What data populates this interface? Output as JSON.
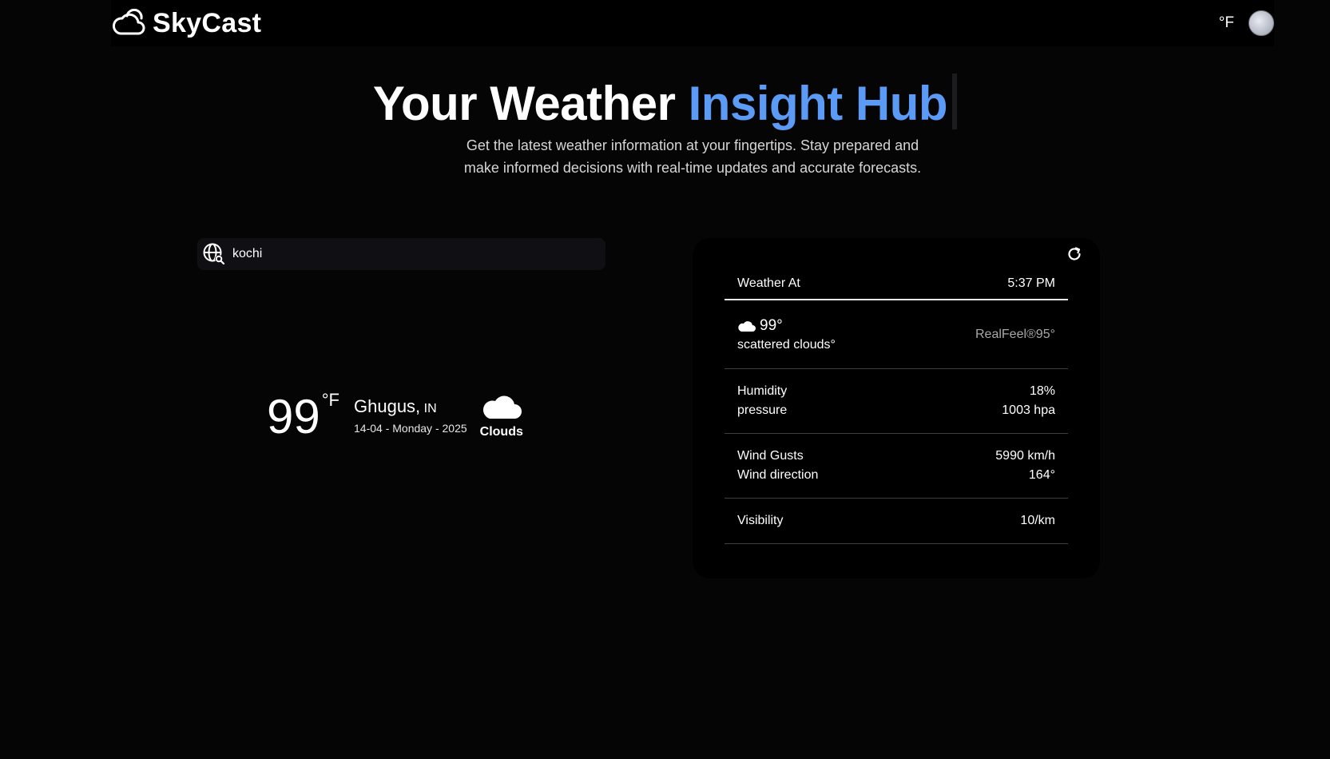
{
  "app": {
    "name": "SkyCast"
  },
  "header": {
    "unit_toggle": "°F"
  },
  "hero": {
    "title_part1": "Your Weather",
    "title_accent": "Insight  Hub",
    "subtitle": "Get the latest weather information at your fingertips. Stay prepared and make informed decisions with real-time updates and accurate forecasts."
  },
  "search": {
    "value": "kochi",
    "placeholder": ""
  },
  "current": {
    "temp": "99",
    "unit": "°F",
    "city": "Ghugus,",
    "country": "IN",
    "date": "14-04 - Monday - 2025",
    "condition": "Clouds"
  },
  "details": {
    "header_label": "Weather At",
    "header_time": "5:37 PM",
    "now_temp": "99°",
    "now_desc": "scattered clouds°",
    "realfeel": "RealFeel®95°",
    "humidity_label": "Humidity",
    "humidity_value": "18%",
    "pressure_label": "pressure",
    "pressure_value": "1003 hpa",
    "gusts_label": "Wind Gusts",
    "gusts_value": "5990 km/h",
    "direction_label": "Wind direction",
    "direction_value": "164°",
    "visibility_label": "Visibility",
    "visibility_value": "10/km"
  },
  "colors": {
    "background": "#050505",
    "accent": "#5b9bf5",
    "card": "#000000",
    "search_bg": "#101014"
  },
  "icons": {
    "brand": "cloud-outline-icon",
    "search": "globe-search-icon",
    "condition": "cloud-icon",
    "refresh": "refresh-icon"
  }
}
